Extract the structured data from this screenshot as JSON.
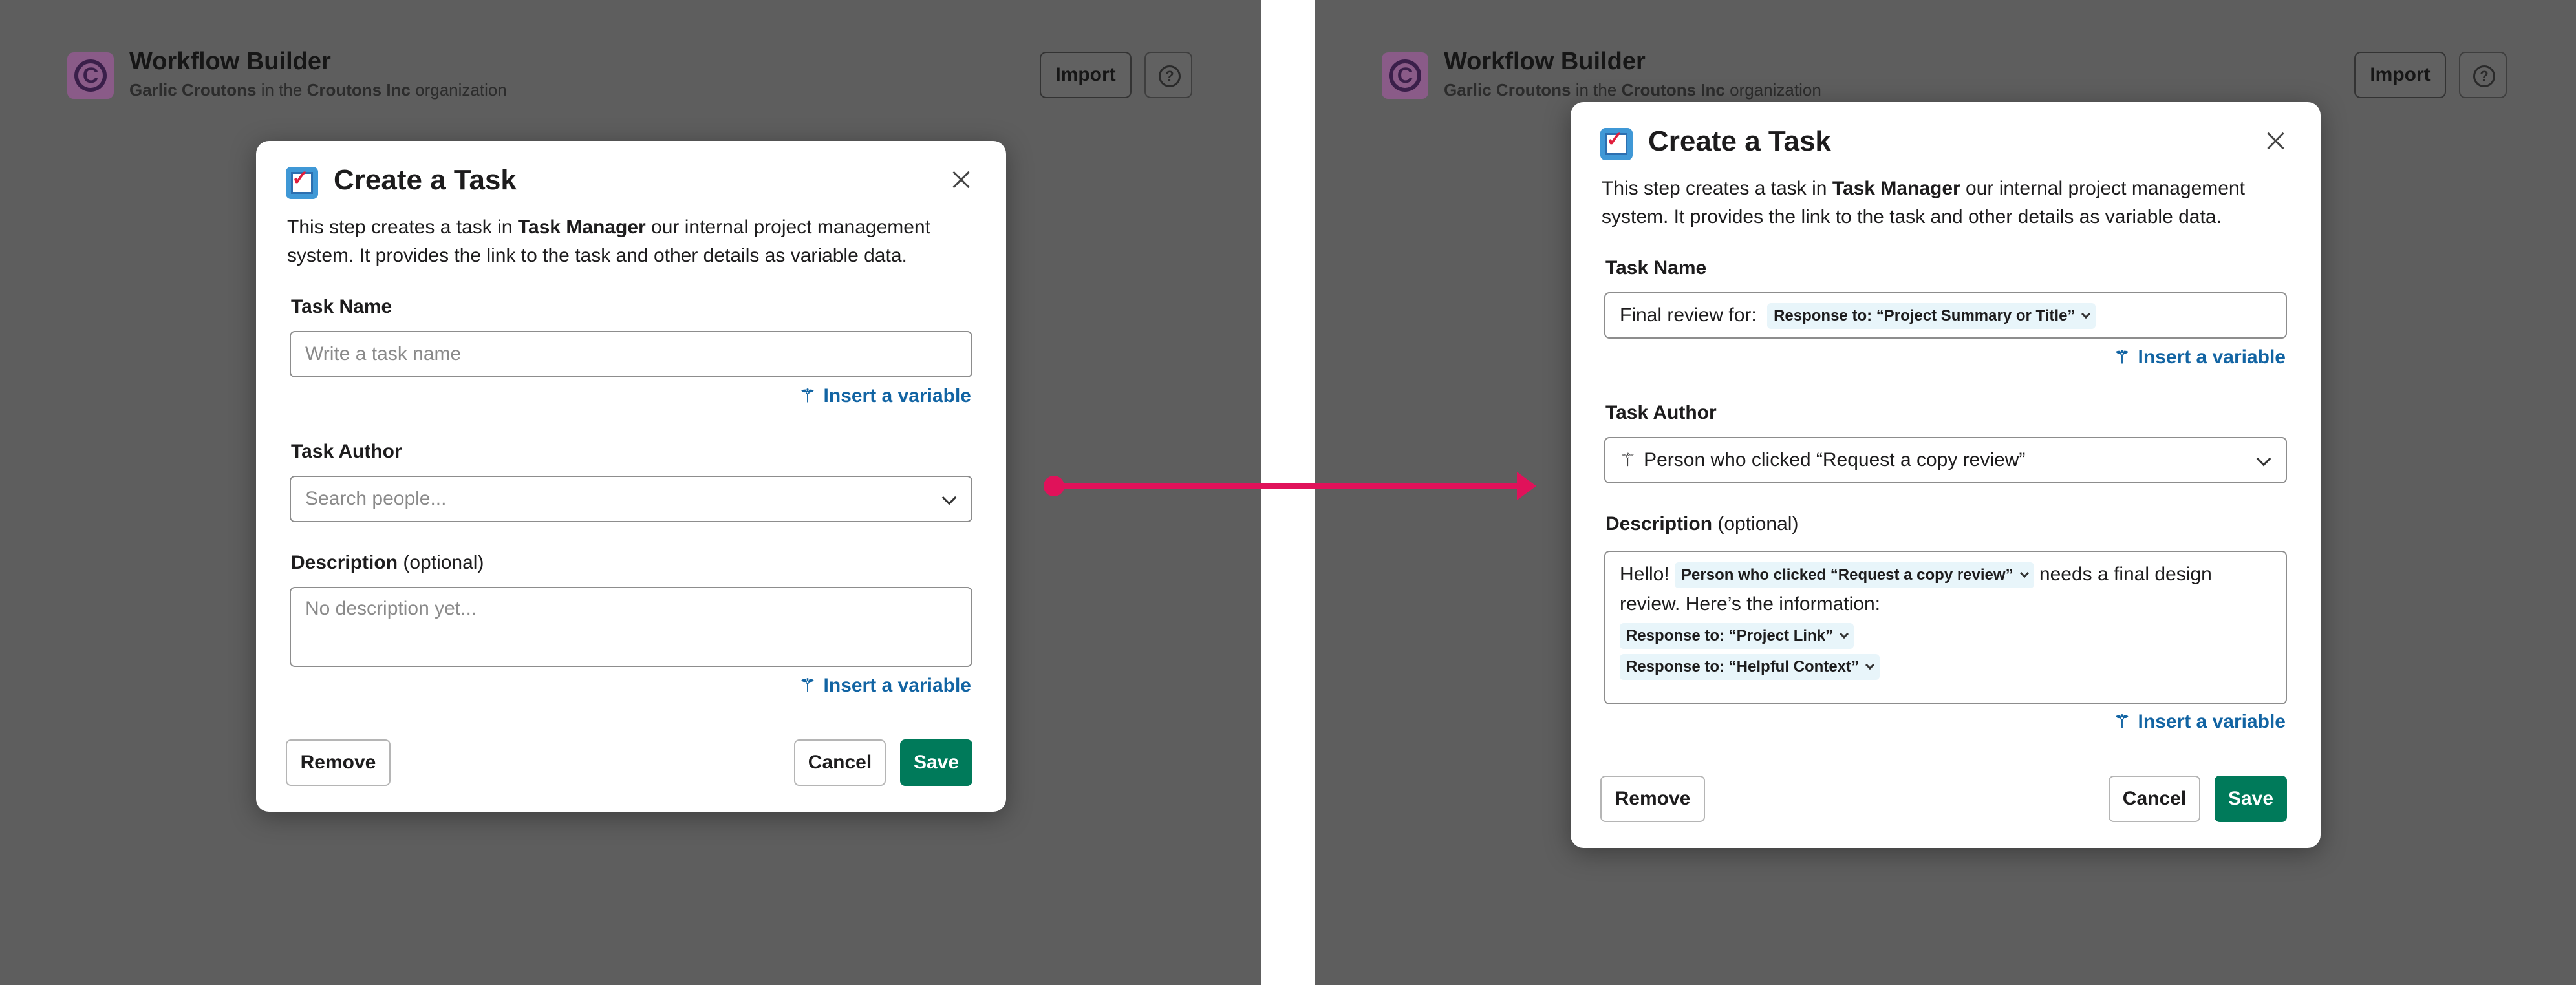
{
  "header": {
    "app_title": "Workflow Builder",
    "workspace_name": "Garlic Croutons",
    "in_the": "in the",
    "org_name": "Croutons Inc",
    "organization_word": "organization",
    "import_label": "Import",
    "help_icon": "question-circle-icon",
    "logo_icon": "croutons-logo-icon"
  },
  "modal": {
    "icon": "ballot-box-check-icon",
    "title": "Create a Task",
    "desc_before": "This step creates a task in",
    "desc_app": "Task Manager",
    "desc_after": "our internal project management system. It provides the link to the task and other details as variable data.",
    "task_name_label": "Task Name",
    "task_author_label": "Task Author",
    "description_label": "Description",
    "optional_label": "(optional)",
    "insert_variable": "Insert a variable",
    "remove_label": "Remove",
    "cancel_label": "Cancel",
    "save_label": "Save"
  },
  "before": {
    "task_name_placeholder": "Write a task name",
    "task_author_placeholder": "Search people...",
    "description_placeholder": "No description yet..."
  },
  "after": {
    "task_name_prefix": "Final review for:",
    "task_name_token": "Response to: “Project Summary or Title”",
    "task_author_value": "Person who clicked “Request a copy review”",
    "description_hello": "Hello!",
    "description_token_person": "Person who clicked “Request a copy review”",
    "description_text": "needs a final design review. Here’s the information:",
    "description_token_link": "Response to: “Project Link”",
    "description_token_context": "Response to: “Helpful Context”"
  },
  "colors": {
    "overlay": "#5e5e5e",
    "arrow": "#e0125a",
    "save_button": "#007a5a",
    "link": "#1264a3",
    "token_bg": "#e8f5fa"
  }
}
